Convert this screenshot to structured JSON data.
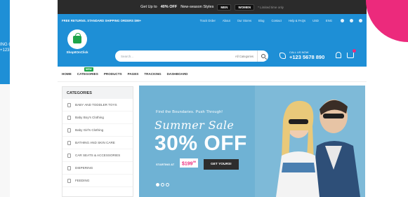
{
  "promo": {
    "lead": "Get Up to",
    "highlight": "40% OFF",
    "tail": "New-season Styles",
    "btn_men": "MEN",
    "btn_women": "WOMEN",
    "note": "* Limited time only"
  },
  "topbar": {
    "shipping": "FREE RETURNS. STANDARD SHIPPING ORDERS $99+",
    "links": [
      "Track Order",
      "About",
      "Our Stores",
      "Blog",
      "Contact",
      "Help & FAQs"
    ],
    "currency": "USD",
    "language": "ENG"
  },
  "left_strip": {
    "text1": "ING OI",
    "text2": "+123"
  },
  "logo": {
    "name": "ShopItOnClick"
  },
  "search": {
    "placeholder": "Search...",
    "category": "All Categories"
  },
  "call": {
    "label": "CALL US NOW",
    "number": "+123 5678 890"
  },
  "nav": {
    "items": [
      "HOME",
      "CATEGORIES",
      "PRODUCTS",
      "PAGES",
      "TRACKING",
      "DASHBOARD"
    ],
    "new_badge": "NEW"
  },
  "categories": {
    "heading": "CATEGORIES",
    "items": [
      "BABY AND TODDLER TOYS",
      "Baby Boy's Clothing",
      "Baby Girl's Clothing",
      "BATHING AND SKIN CARE",
      "CAR SEATS & ACCESSORIES",
      "DIEPERING",
      "FEEDING"
    ]
  },
  "banner": {
    "tagline": "Find the Boundaries. Push Through!",
    "title": "Summer Sale",
    "percent": "30% OFF",
    "starting": "STARTING AT",
    "price": "$199",
    "price_cents": "99",
    "cta": "GET YOURS!"
  },
  "colors": {
    "brand_blue": "#1e8fd6",
    "accent_pink": "#ec2a7c",
    "promo_dark": "#2b2b2b",
    "logo_green": "#1ea54a"
  }
}
